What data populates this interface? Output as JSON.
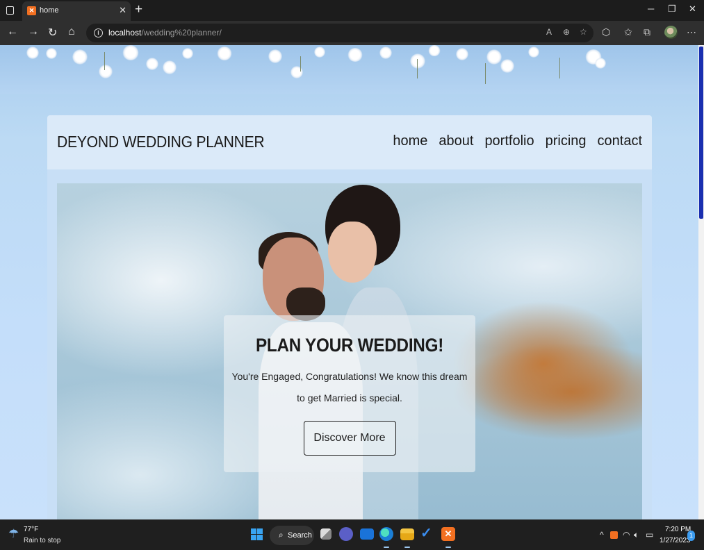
{
  "browser": {
    "tab_title": "home",
    "tab_favicon": "xampp-icon",
    "new_tab_label": "+",
    "url_host": "localhost",
    "url_path": "/wedding%20planner/",
    "icons": [
      "tab-actions-icon",
      "back-icon",
      "forward-icon",
      "refresh-icon",
      "home-icon",
      "site-info-icon",
      "read-aloud-icon",
      "zoom-icon",
      "favorite-add-icon",
      "extensions-icon",
      "favorites-icon",
      "collections-icon",
      "profile-avatar",
      "more-icon"
    ]
  },
  "site": {
    "brand": "DEYOND WEDDING PLANNER",
    "nav": [
      "home",
      "about",
      "portfolio",
      "pricing",
      "contact"
    ],
    "hero": {
      "title": "PLAN YOUR WEDDING!",
      "text": "You're Engaged, Congratulations! We know this dream to get Married is special.",
      "button": "Discover More"
    }
  },
  "taskbar": {
    "weather_temp": "77°F",
    "weather_condition": "Rain to stop",
    "search_label": "Search",
    "time": "7:20 PM",
    "date": "1/27/2023",
    "notification_count": "1",
    "pinned_apps": [
      "start-icon",
      "search-icon",
      "task-view-icon",
      "teams-icon",
      "mail-icon",
      "edge-icon",
      "file-explorer-icon",
      "todo-icon",
      "xampp-icon"
    ]
  },
  "colors": {
    "accent": "#39a4f2",
    "page_bg": "#c4defa",
    "header_bg": "#dbeaf9",
    "scroll_thumb": "#1a2fb0"
  }
}
